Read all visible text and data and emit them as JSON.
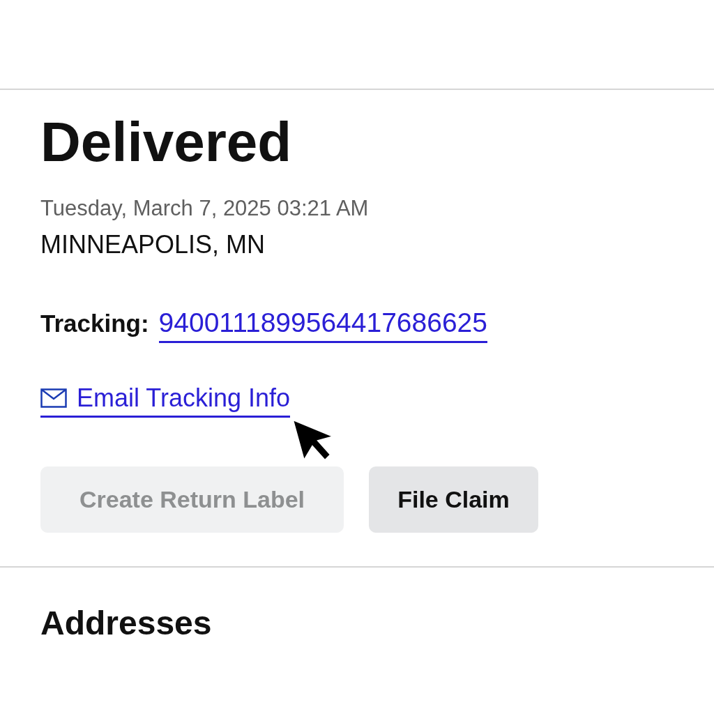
{
  "status": {
    "title": "Delivered",
    "datetime": "Tuesday, March 7, 2025 03:21 AM",
    "location": "MINNEAPOLIS, MN"
  },
  "tracking": {
    "label": "Tracking:",
    "number": "9400111899564417686625"
  },
  "email_link": {
    "label": "Email Tracking Info"
  },
  "buttons": [
    {
      "label": "Create Return Label",
      "disabled": true
    },
    {
      "label": "File Claim",
      "disabled": false
    }
  ],
  "addresses": {
    "title": "Addresses"
  }
}
